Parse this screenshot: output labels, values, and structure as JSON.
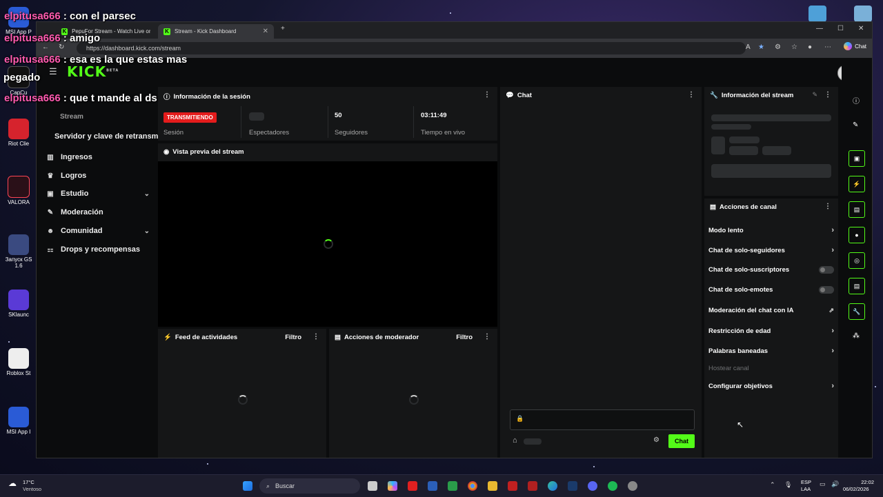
{
  "chat_overlay": [
    {
      "user": "elpitusa666",
      "text": " : con el parsec"
    },
    {
      "user": "elpitusa666",
      "text": " : amigo"
    },
    {
      "user": "elpitusa666",
      "text": " : esa es la que estas mas"
    },
    {
      "user": "",
      "text": "pegado"
    },
    {
      "user": "elpitusa666",
      "text": " : que t mande al ds"
    }
  ],
  "desktop_icons": [
    "MSI App P",
    "CapCu",
    "Riot Clie",
    "VALORA",
    "Запуск GS 1.6",
    "SKlaunc",
    "Roblox St",
    "MSI App I"
  ],
  "browser": {
    "tabs": [
      {
        "label": "PepuFor Stream - Watch Live on Ki",
        "active": false
      },
      {
        "label": "Stream - Kick Dashboard",
        "active": true
      }
    ],
    "url": "https://dashboard.kick.com/stream",
    "copilot_label": "Chat",
    "tab_fav": "K"
  },
  "app": {
    "logo": "KICK",
    "logo_sup": "BETA",
    "sidebar_partial": "Stream",
    "sidebar": [
      {
        "label": "Servidor y clave de retransm",
        "icon": "",
        "chevron": false
      },
      {
        "label": "Ingresos",
        "icon": "chart-icon",
        "chevron": false
      },
      {
        "label": "Logros",
        "icon": "trophy-icon",
        "chevron": false
      },
      {
        "label": "Estudio",
        "icon": "studio-icon",
        "chevron": true
      },
      {
        "label": "Moderación",
        "icon": "wrench-icon",
        "chevron": false
      },
      {
        "label": "Comunidad",
        "icon": "community-icon",
        "chevron": true
      },
      {
        "label": "Drops y recompensas",
        "icon": "gift-icon",
        "chevron": false
      }
    ],
    "session": {
      "title": "Información de la sesión",
      "badge": "TRANSMITIENDO",
      "stats": [
        {
          "value": "",
          "label": "Sesión"
        },
        {
          "value": "",
          "label": "Espectadores"
        },
        {
          "value": "50",
          "label": "Seguidores"
        },
        {
          "value": "03:11:49",
          "label": "Tiempo en vivo"
        }
      ]
    },
    "preview": {
      "title": "Vista previa del stream"
    },
    "feed": {
      "title": "Feed de actividades",
      "filter": "Filtro"
    },
    "modactions": {
      "title": "Acciones de moderador",
      "filter": "Filtro"
    },
    "chat": {
      "title": "Chat",
      "send": "Chat"
    },
    "stream_info": {
      "title": "Información del stream"
    },
    "channel_actions": {
      "title": "Acciones de canal",
      "items": [
        {
          "label": "Modo lento",
          "control": "arrow"
        },
        {
          "label": "Chat de solo-seguidores",
          "control": "arrow"
        },
        {
          "label": "Chat de solo-suscriptores",
          "control": "toggle"
        },
        {
          "label": "Chat de solo-emotes",
          "control": "toggle"
        },
        {
          "label": "Moderación del chat con IA",
          "control": "external"
        },
        {
          "label": "Restricción de edad",
          "control": "arrow"
        },
        {
          "label": "Palabras baneadas",
          "control": "arrow"
        },
        {
          "label": "Hostear canal",
          "control": "disabled"
        },
        {
          "label": "Configurar objetivos",
          "control": "arrow"
        }
      ]
    }
  },
  "taskbar": {
    "weather_temp": "17°C",
    "weather_desc": "Ventoso",
    "search": "Buscar",
    "lang": "ESP",
    "lang2": "LAA",
    "time": "22:02",
    "date": "06/02/2026"
  }
}
